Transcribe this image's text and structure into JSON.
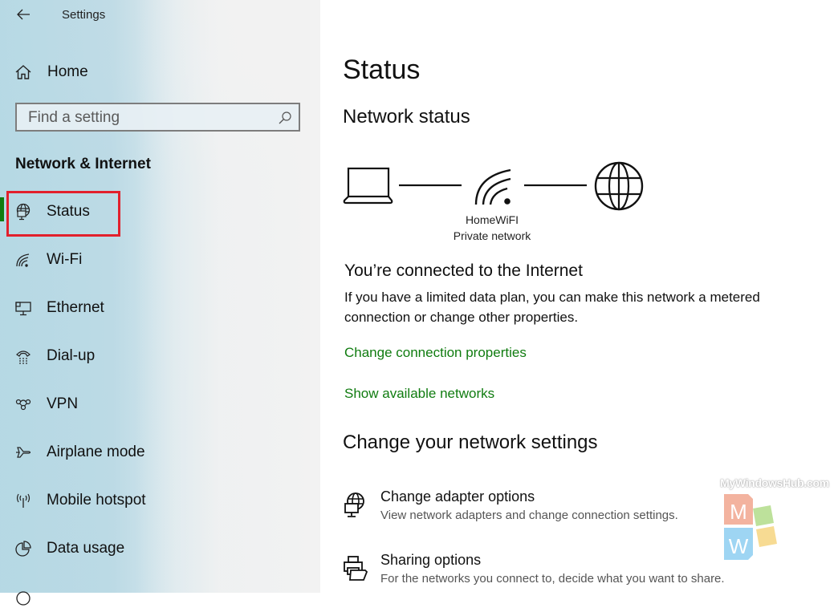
{
  "window": {
    "title": "Settings",
    "back_icon": "arrow-left-icon"
  },
  "sidebar": {
    "home_label": "Home",
    "search": {
      "placeholder": "Find a setting",
      "value": ""
    },
    "section_title": "Network & Internet",
    "selected": "Status",
    "items": [
      {
        "label": "Status",
        "icon": "globe-monitor-icon"
      },
      {
        "label": "Wi-Fi",
        "icon": "wifi-icon"
      },
      {
        "label": "Ethernet",
        "icon": "ethernet-icon"
      },
      {
        "label": "Dial-up",
        "icon": "dialup-phone-icon"
      },
      {
        "label": "VPN",
        "icon": "vpn-icon"
      },
      {
        "label": "Airplane mode",
        "icon": "airplane-icon"
      },
      {
        "label": "Mobile hotspot",
        "icon": "hotspot-icon"
      },
      {
        "label": "Data usage",
        "icon": "pie-chart-icon"
      }
    ]
  },
  "main": {
    "page_title": "Status",
    "network_status_title": "Network status",
    "network": {
      "name": "HomeWiFI",
      "type": "Private network"
    },
    "connected_heading": "You’re connected to the Internet",
    "connected_desc": "If you have a limited data plan, you can make this network a metered connection or change other properties.",
    "links": {
      "change_connection": "Change connection properties",
      "show_networks": "Show available networks"
    },
    "change_settings_title": "Change your network settings",
    "options": [
      {
        "title": "Change adapter options",
        "desc": "View network adapters and change connection settings.",
        "icon": "adapter-globe-icon"
      },
      {
        "title": "Sharing options",
        "desc": "For the networks you connect to, decide what you want to share.",
        "icon": "sharing-printer-icon"
      }
    ]
  },
  "watermark": {
    "text": "MyWindowsHub.com",
    "letters": [
      "M",
      "W"
    ]
  },
  "colors": {
    "accent": "#107c10",
    "highlight_box": "#e2202c"
  }
}
